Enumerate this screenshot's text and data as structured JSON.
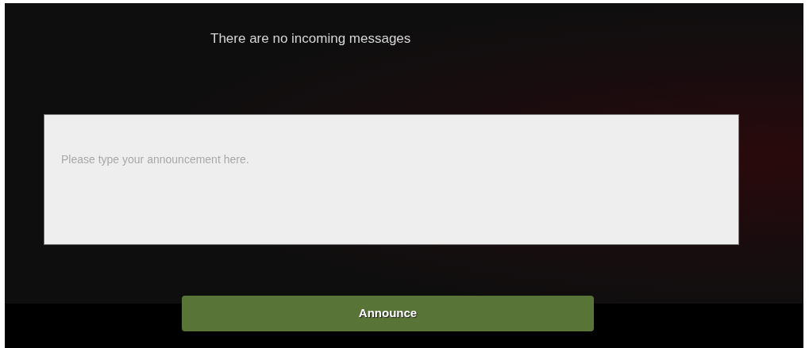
{
  "messages": {
    "empty_text": "There are no incoming messages"
  },
  "announcement": {
    "placeholder": "Please type your announcement here."
  },
  "announce_button": {
    "label": "Announce"
  }
}
